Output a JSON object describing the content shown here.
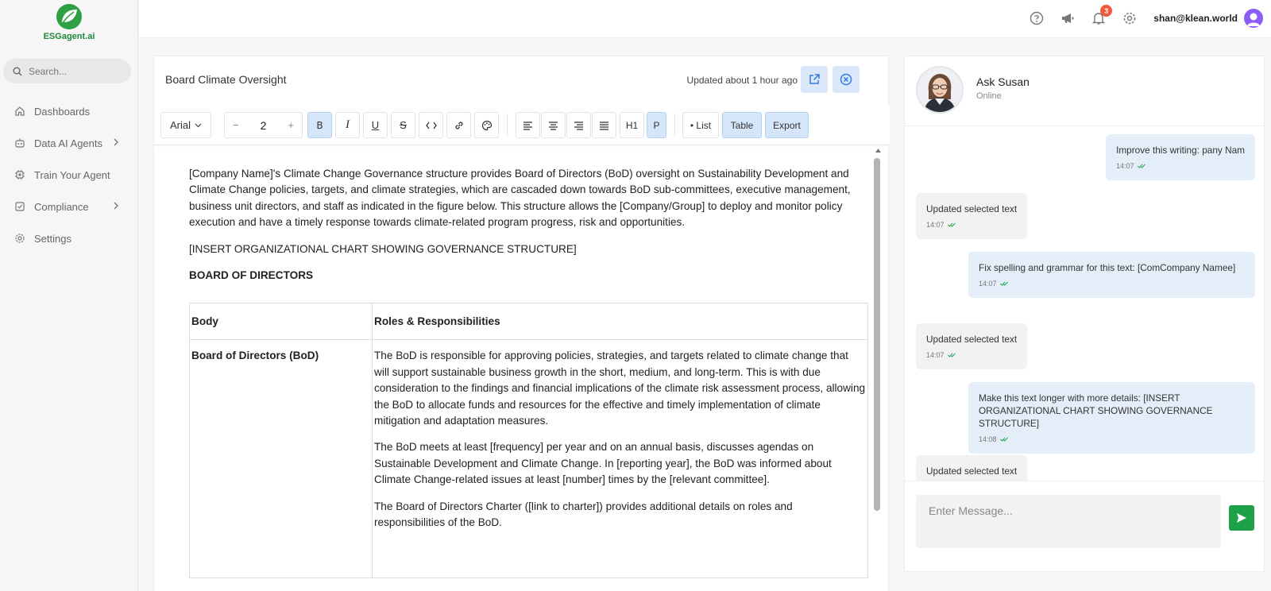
{
  "app": {
    "logo_text": "ESGagent.ai",
    "brand_color": "#1e8a3a"
  },
  "sidebar": {
    "search_placeholder": "Search...",
    "items": [
      {
        "label": "Dashboards",
        "icon": "home-icon"
      },
      {
        "label": "Data AI Agents",
        "icon": "robot-icon",
        "has_submenu": true
      },
      {
        "label": "Train Your Agent",
        "icon": "chip-icon"
      },
      {
        "label": "Compliance",
        "icon": "checkbox-icon",
        "has_submenu": true
      },
      {
        "label": "Settings",
        "icon": "gear-icon"
      }
    ]
  },
  "topbar": {
    "notification_count": "3",
    "user_email": "shan@klean.world"
  },
  "document": {
    "title": "Board Climate Oversight",
    "updated_prefix": "Updated about ",
    "updated_value": "1 hour ago"
  },
  "toolbar": {
    "font": "Arial",
    "size_minus": "−",
    "size": "2",
    "size_plus": "+",
    "bold": "B",
    "italic": "I",
    "underline": "U",
    "strike": "S",
    "h1": "H1",
    "p": "P",
    "list": "• List",
    "table": "Table",
    "export": "Export"
  },
  "content": {
    "para1": "[Company Name]'s Climate Change Governance structure provides Board of Directors (BoD) oversight on Sustainability Development and Climate Change policies, targets, and climate strategies, which are cascaded down towards BoD sub-committees, executive management, business unit directors, and staff as indicated in the figure below. This structure allows the [Company/Group] to deploy and monitor policy execution and have a timely response towards climate-related program progress, risk and opportunities.",
    "para2": "[INSERT ORGANIZATIONAL CHART SHOWING GOVERNANCE STRUCTURE]",
    "heading": "BOARD OF DIRECTORS",
    "table": {
      "headers": [
        "Body",
        "Roles & Responsibilities"
      ],
      "row1": {
        "body": "Board of Directors (BoD)",
        "r1": "The BoD is responsible for approving policies, strategies, and targets related to climate change that will support sustainable business growth in the short, medium, and long-term. This is with due consideration to the findings and financial implications of the climate risk assessment process, allowing the BoD to allocate funds and resources for the effective and timely implementation of climate mitigation and adaptation measures.",
        "r2": "The BoD meets at least [frequency] per year and on an annual basis, discusses agendas on Sustainable Development and Climate Change. In [reporting year], the BoD was informed about Climate Change-related issues at least [number] times by the [relevant committee].",
        "r3": "The Board of Directors Charter ([link to charter]) provides additional details on roles and responsibilities of the BoD."
      }
    }
  },
  "chat": {
    "agent_name": "Ask Susan",
    "agent_status": "Online",
    "messages": [
      {
        "text": "Improve this writing: pany Nam",
        "time": "14:07"
      },
      {
        "text": "Updated selected text",
        "time": "14:07"
      },
      {
        "text": "Fix spelling and grammar for this text: [ComCompany Namee]",
        "time": "14:07"
      },
      {
        "text": "Updated selected text",
        "time": "14:07"
      },
      {
        "text": "Make this text longer with more details: [INSERT ORGANIZATIONAL CHART SHOWING GOVERNANCE STRUCTURE]",
        "time": "14:08"
      },
      {
        "text": "Updated selected text",
        "time": ""
      }
    ],
    "input_placeholder": "Enter Message..."
  }
}
